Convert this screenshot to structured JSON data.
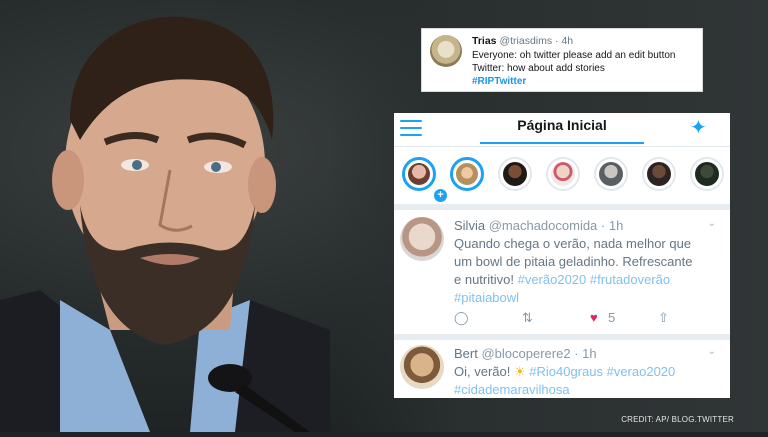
{
  "tweet": {
    "name": "Trias",
    "handle": "@triasdims",
    "sep": "·",
    "time": "4h",
    "line1": "Everyone: oh twitter please add an edit button",
    "line2": "Twitter: how about add stories",
    "hashtag": "#RIPTwitter"
  },
  "app": {
    "title": "Página Inicial",
    "accent": "#1da1f2",
    "menu_icon": "hamburger-menu-icon",
    "sparkle_icon": "sparkle-icon"
  },
  "stories": [
    "story-1",
    "story-2",
    "story-3",
    "story-4",
    "story-5",
    "story-6",
    "story-7"
  ],
  "posts": [
    {
      "name": "Silvia",
      "handle": "@machadocomida",
      "sep": "·",
      "time": "1h",
      "text_a": "Quando chega o verão, nada melhor que",
      "text_b": "um bowl de pitaia geladinho. Refrescante",
      "text_c": "e nutritivo! ",
      "tag1": "#verão2020",
      "tag2": "#frutadoverão",
      "tag3": "#pitaiabowl",
      "likes": "5"
    },
    {
      "name": "Bert",
      "handle": "@blocoperere2",
      "sep": "·",
      "time": "1h",
      "text_a": "Oi, verão! ",
      "tag1": "#Rio40graus",
      "tag2": "#verao2020",
      "tag3": "#cidademaravilhosa"
    }
  ],
  "credit": "CREDIT: AP/ BLOG.TWITTER"
}
